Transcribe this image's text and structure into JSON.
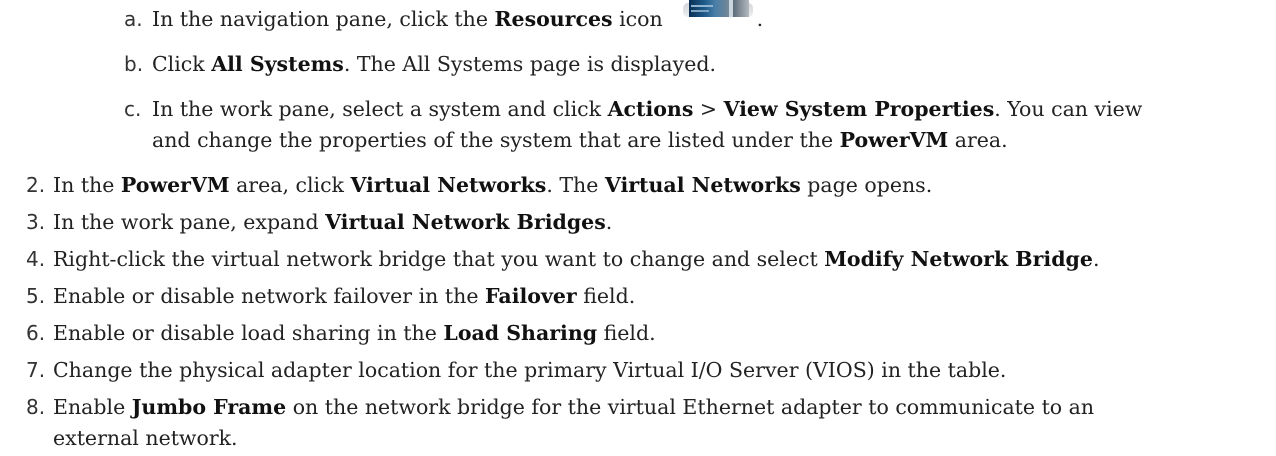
{
  "steps": {
    "sub_a": {
      "marker": "a.",
      "pre": "In the navigation pane, click the ",
      "bold": "Resources",
      "post": " icon",
      "end": "."
    },
    "sub_b": {
      "marker": "b.",
      "pre": "Click ",
      "bold": "All Systems",
      "post": ". The All Systems page is displayed."
    },
    "sub_c": {
      "marker": "c.",
      "pre": "In the work pane, select a system and click ",
      "bold1": "Actions",
      "mid": " > ",
      "bold2": "View System Properties",
      "post": ". You can view",
      "line2_pre": "and change the properties of the system that are listed under the ",
      "line2_bold": "PowerVM",
      "line2_post": " area."
    },
    "step2": {
      "marker": "2.",
      "pre": "In the ",
      "bold1": "PowerVM",
      "mid1": " area, click ",
      "bold2": "Virtual Networks",
      "mid2": ". The ",
      "bold3": "Virtual Networks",
      "post": " page opens."
    },
    "step3": {
      "marker": "3.",
      "pre": "In the work pane, expand ",
      "bold": "Virtual Network Bridges",
      "post": "."
    },
    "step4": {
      "marker": "4.",
      "pre": "Right-click the virtual network bridge that you want to change and select ",
      "bold": "Modify Network Bridge",
      "post": "."
    },
    "step5": {
      "marker": "5.",
      "pre": "Enable or disable network failover in the ",
      "bold": "Failover",
      "post": " field."
    },
    "step6": {
      "marker": "6.",
      "pre": "Enable or disable load sharing in the ",
      "bold": "Load Sharing",
      "post": " field."
    },
    "step7": {
      "marker": "7.",
      "text": "Change the physical adapter location for the primary Virtual I/O Server (VIOS) in the table."
    },
    "step8": {
      "marker": "8.",
      "pre": "Enable ",
      "bold": "Jumbo Frame",
      "post": " on the network bridge for the virtual Ethernet adapter to communicate to an",
      "line2": "external network."
    }
  },
  "icons": {
    "resources": "resources-icon"
  }
}
